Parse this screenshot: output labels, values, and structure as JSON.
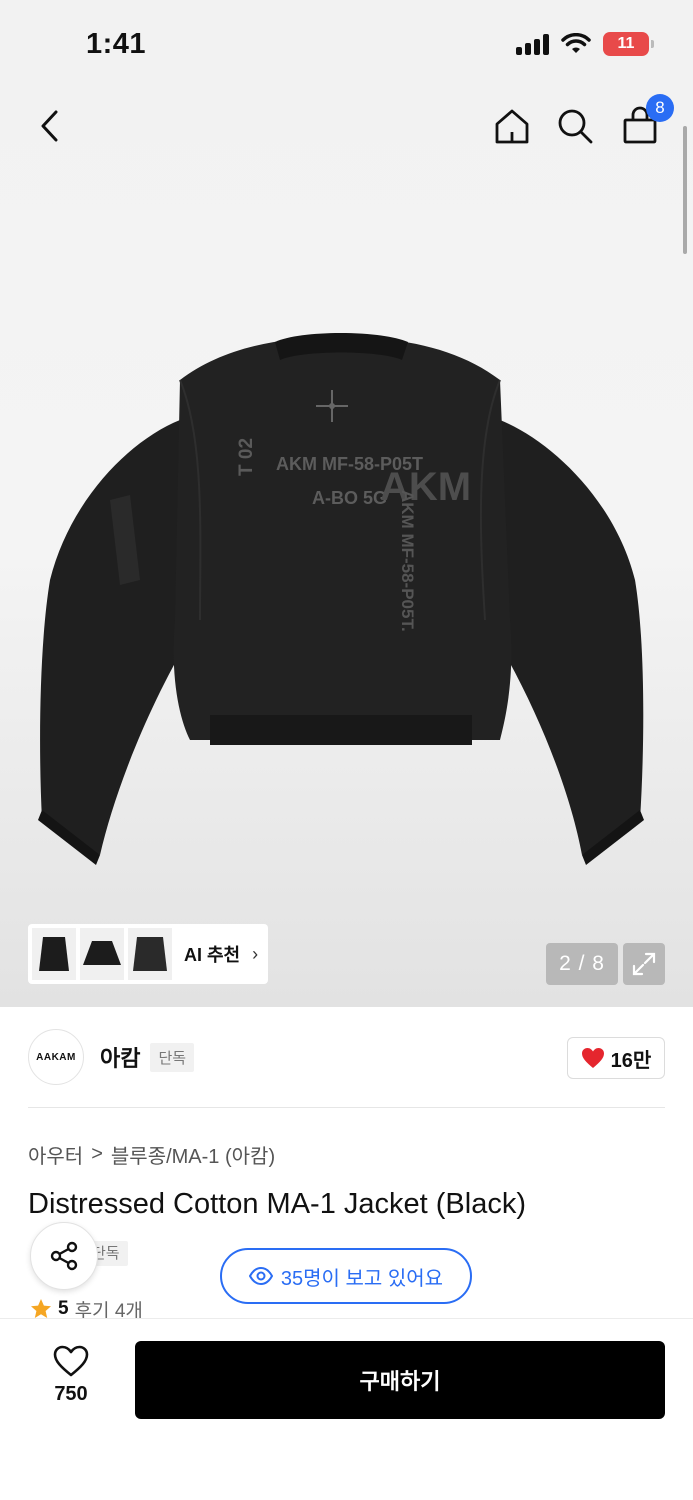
{
  "status_bar": {
    "time": "1:41",
    "battery": "11"
  },
  "header": {
    "cart_count": "8"
  },
  "gallery": {
    "page_counter": "2 / 8",
    "ai_recommend_label": "AI 추천"
  },
  "jacket_print": {
    "text_line_1": "AKM MF-58-P05T",
    "text_line_2": "A-BO 5G",
    "text_side": "T 02",
    "text_vertical": "AKM MF-58-P05T.",
    "text_logo": "AKM"
  },
  "brand": {
    "logo_text": "AAKAM",
    "name": "아캄",
    "tag": "단독",
    "like_count": "16만"
  },
  "breadcrumb": {
    "category": "아우터",
    "separator": ">",
    "subcategory": "블루종/MA-1 (아캄)"
  },
  "product": {
    "title": "Distressed Cotton MA-1 Jacket (Black)",
    "exclusive_tag": "단독",
    "viewers_text": "35명이 보고 있어요",
    "rating": "5",
    "review_text": "후기 4개"
  },
  "bottom_bar": {
    "wish_count": "750",
    "buy_label": "구매하기"
  },
  "colors": {
    "accent_blue": "#2a6df4",
    "heart_red": "#e5262e",
    "battery_red": "#e84a4a",
    "star_orange": "#f5a623",
    "buy_black": "#000000"
  }
}
